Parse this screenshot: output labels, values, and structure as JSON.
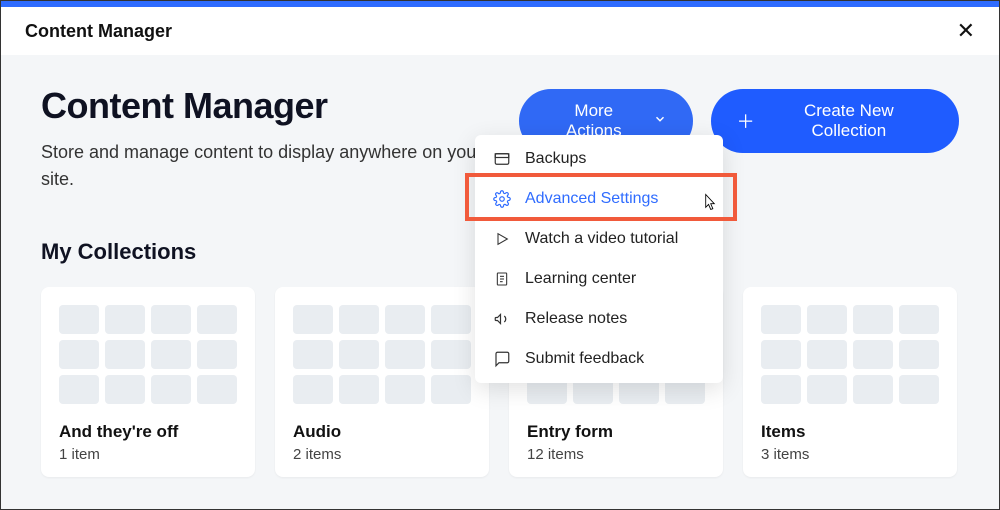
{
  "topbar": {
    "title": "Content Manager"
  },
  "page": {
    "title": "Content Manager",
    "description": "Store and manage content to display anywhere on your site."
  },
  "buttons": {
    "more": "More Actions",
    "create": "Create New Collection"
  },
  "menu": {
    "items": [
      {
        "icon": "backup-icon",
        "label": "Backups"
      },
      {
        "icon": "gear-icon",
        "label": "Advanced Settings"
      },
      {
        "icon": "play-icon",
        "label": "Watch a video tutorial"
      },
      {
        "icon": "doc-icon",
        "label": "Learning center"
      },
      {
        "icon": "megaphone-icon",
        "label": "Release notes"
      },
      {
        "icon": "feedback-icon",
        "label": "Submit feedback"
      }
    ],
    "highlight_index": 1
  },
  "section": {
    "title": "My Collections"
  },
  "collections": [
    {
      "name": "And they're off",
      "count": "1 item"
    },
    {
      "name": "Audio",
      "count": "2 items"
    },
    {
      "name": "Entry form",
      "count": "12 items"
    },
    {
      "name": "Items",
      "count": "3 items"
    }
  ]
}
